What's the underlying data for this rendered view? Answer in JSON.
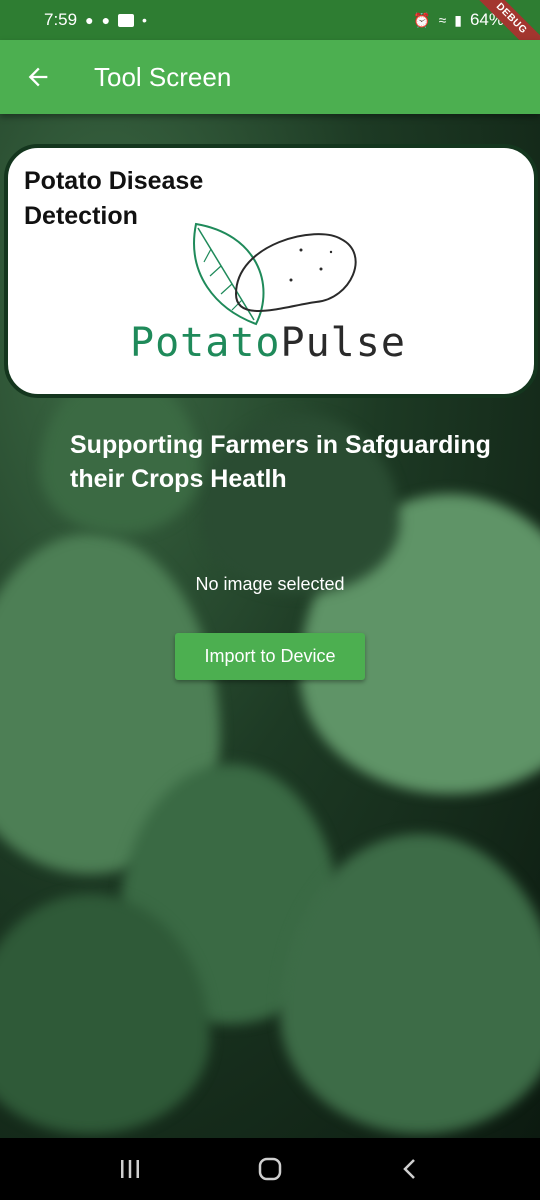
{
  "status_bar": {
    "time": "7:59",
    "battery": "64%",
    "debug_label": "DEBUG"
  },
  "app_bar": {
    "title": "Tool Screen",
    "back_icon": "arrow-left-icon"
  },
  "card": {
    "title": "Potato Disease Detection",
    "logo_word1": "Potato",
    "logo_word2": "Pulse"
  },
  "main": {
    "subtitle": "Supporting Farmers in Safguarding their Crops Heatlh",
    "image_status": "No image selected",
    "import_button": "Import to Device"
  },
  "nav": {
    "recents_icon": "recents-icon",
    "home_icon": "home-icon",
    "back_icon": "back-chevron-icon"
  },
  "colors": {
    "status_bar": "#2e7d32",
    "app_bar": "#4caf50",
    "button": "#4caf50",
    "card_border": "#14361e"
  }
}
